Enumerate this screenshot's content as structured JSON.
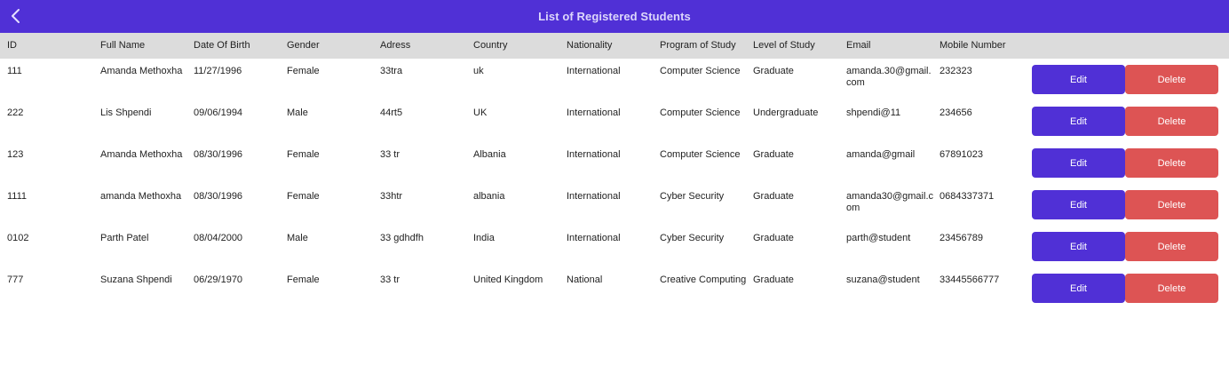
{
  "header": {
    "title": "List of Registered Students",
    "back_icon": "chevron-left-icon"
  },
  "columns": [
    "ID",
    "Full Name",
    "Date Of Birth",
    "Gender",
    "Adress",
    "Country",
    "Nationality",
    "Program of Study",
    "Level of Study",
    "Email",
    "Mobile Number"
  ],
  "actions": {
    "edit_label": "Edit",
    "delete_label": "Delete"
  },
  "rows": [
    [
      "111",
      "Amanda Methoxha",
      "11/27/1996",
      "Female",
      "33tra",
      "uk",
      "International",
      "Computer Science",
      "Graduate",
      "amanda.30@gmail.com",
      "232323"
    ],
    [
      "222",
      "Lis Shpendi",
      "09/06/1994",
      "Male",
      "44rt5",
      "UK",
      "International",
      "Computer Science",
      "Undergraduate",
      "shpendi@11",
      "234656"
    ],
    [
      "123",
      "Amanda Methoxha",
      "08/30/1996",
      "Female",
      "33 tr",
      "Albania",
      "International",
      "Computer Science",
      "Graduate",
      "amanda@gmail",
      "67891023"
    ],
    [
      "1111",
      "amanda Methoxha",
      "08/30/1996",
      "Female",
      "33htr",
      "albania",
      "International",
      "Cyber Security",
      "Graduate",
      "amanda30@gmail.com",
      "0684337371"
    ],
    [
      "0102",
      "Parth Patel",
      "08/04/2000",
      "Male",
      "33 gdhdfh",
      "India",
      "International",
      "Cyber Security",
      "Graduate",
      "parth@student",
      "23456789"
    ],
    [
      "777",
      "Suzana Shpendi",
      "06/29/1970",
      "Female",
      "33 tr",
      "United Kingdom",
      "National",
      "Creative Computing",
      "Graduate",
      "suzana@student",
      "33445566777"
    ]
  ],
  "colors": {
    "accent": "#5030d6",
    "danger": "#dd5454",
    "header_bg": "#dcdcdc"
  }
}
